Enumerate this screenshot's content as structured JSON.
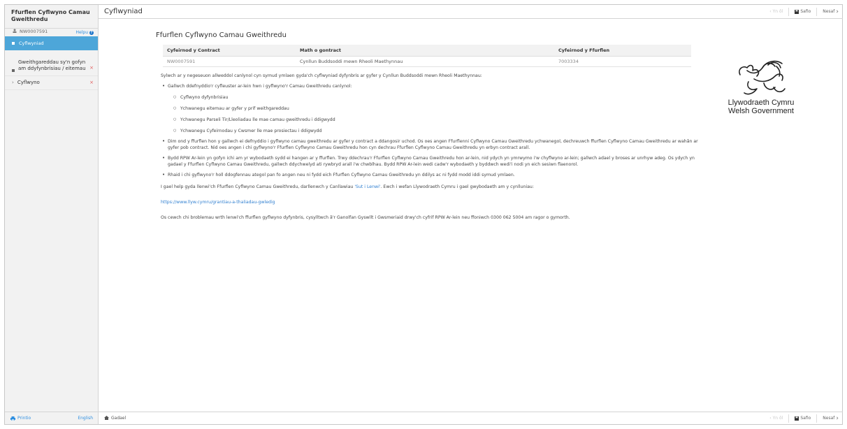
{
  "sidebar": {
    "title": "Ffurflen Cyflwyno Camau Gweithredu",
    "reference": "NW0007591",
    "help_label": "Helpu",
    "items": [
      {
        "label": "Cyflwyniad",
        "active": true
      },
      {
        "label": "Gweithgareddau sy'n gofyn am ddyfynbrisiau / eitemau",
        "active": false
      },
      {
        "label": "Cyflwyno",
        "active": false
      }
    ],
    "footer": {
      "print_label": "Printio",
      "language_label": "English"
    }
  },
  "topbar": {
    "heading": "Cyflwyniad",
    "toolbar": {
      "back_label": "Yn ôl",
      "save_label": "Safio",
      "next_label": "Nesaf"
    }
  },
  "bottombar": {
    "exit_label": "Gadael",
    "toolbar": {
      "back_label": "Yn ôl",
      "save_label": "Safio",
      "next_label": "Nesaf"
    }
  },
  "main": {
    "form_title": "Ffurflen Cyflwyno Camau Gweithredu",
    "table": {
      "headers": [
        "Cyfeirnod y Contract",
        "Math o gontract",
        "Cyfeirnod y Ffurflen"
      ],
      "row": [
        "NW0007591",
        "Cynllun Buddsoddi mewn Rheoli Maethynnau",
        "7003334"
      ]
    },
    "intro": "Sylwch ar y negeseuon allweddol canlynol cyn symud ymlaen gyda'ch cyflwyniad dyfynbris ar gyfer y Cynllun Buddsoddi mewn Rheoli Maethynnau:",
    "bullet_1": "Gallwch ddefnyddio'r cyfleuster ar-lein hwn i gyflwyno'r Camau Gweithredu canlynol:",
    "sub_bullets": [
      "Cyflwyno dyfynbrisiau",
      "Ychwanegu eitemau ar gyfer y prif weithgareddau",
      "Ychwanegu Parseli Tir/Lleoliadau lle mae camau gweithredu i ddigwydd",
      "Ychwanegu Cyfeirnodau y Cwsmer lle mae prosiectau i ddigwydd"
    ],
    "bullet_2": "Dim ond y ffurflen hon y gallwch ei defnyddio i gyflwyno camau gweithredu ar gyfer y contract a ddangosir uchod. Os oes angen Ffurflenni Cyflwyno Camau Gweithredu ychwanegol, dechreuwch ffurflen Cyflwyno Camau Gweithredu ar wahân ar gyfer pob contract. Nid oes angen i chi gyflwyno'r Ffurflen Cyflwyno Camau Gweithredu hon cyn dechrau Ffurflen Cyflwyno Camau Gweithredu yn erbyn contract arall.",
    "bullet_3": "Bydd RPW Ar-lein yn gofyn ichi am yr wybodaeth sydd ei hangen ar y ffurflen. Trwy ddechrau'r Ffurflen Cyflwyno Camau Gweithredu hon ar-lein, nid ydych yn ymrwymo i'w chyflwyno ar-lein; gallwch adael y broses ar unrhyw adeg. Os ydych yn gadael y Ffurflen Cyflwyno Camau Gweithredu, gallwch ddychwelyd ati rywbryd arall i'w chwblhau. Bydd RPW Ar-lein wedi cadw'r wybodaeth y byddwch wedi'i nodi yn eich sesiwn flaenorol.",
    "bullet_4": "Rhaid i chi gyflwyno'r holl ddogfennau ategol pan fo angen neu ni fydd eich Ffurflen Cyflwyno Camau Gweithredu yn ddilys ac ni fydd modd iddi symud ymlaen.",
    "help_para_before": "I gael help gyda llenwi'ch Ffurflen Cyflwyno Camau Gweithredu, darllenwch y Canllawiau ",
    "help_link": "'Sut i Lenwi'",
    "help_para_after": ". Ewch i wefan Llywodraeth Cymru i gael gwybodaeth am y cynlluniau:",
    "url": "https://www.llyw.cymru/grantiau-a-thaliadau-gwledig",
    "contact_para": "Os cewch chi broblemau wrth lenwi'ch ffurflen gyflwyno dyfynbris, cysylltwch â'r Ganolfan Gyswllt i Gwsmeriaid drwy'ch cyfrif RPW Ar-lein neu ffoniwch 0300 062 5004 am ragor o gymorth."
  },
  "logo": {
    "line1": "Llywodraeth Cymru",
    "line2": "Welsh Government"
  },
  "colors": {
    "accent": "#4da6d9",
    "link": "#2f7fd0",
    "error": "#e05a5a"
  }
}
